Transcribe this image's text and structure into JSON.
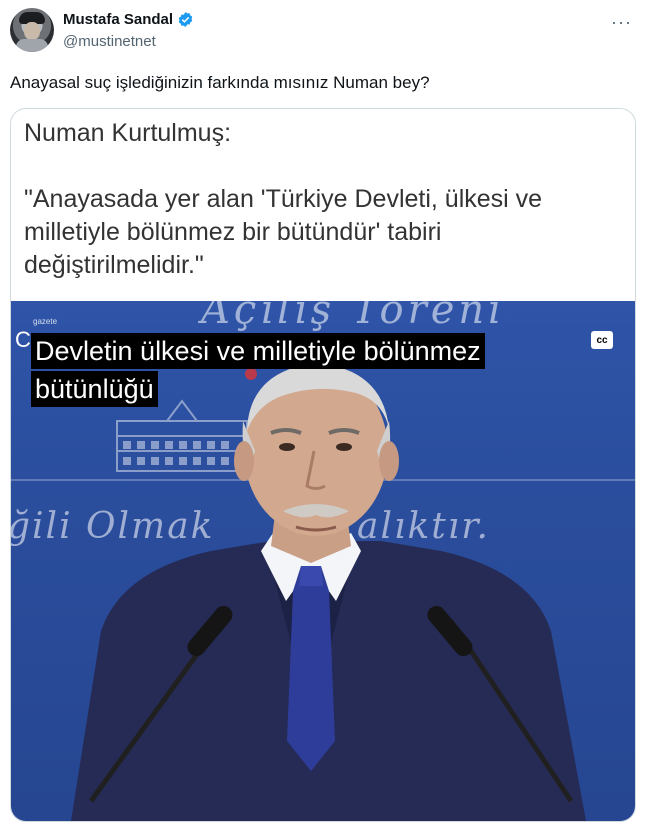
{
  "author": {
    "display_name": "Mustafa Sandal",
    "handle": "@mustinetnet",
    "verified_color": "#1d9bf0"
  },
  "more_label": "···",
  "tweet": {
    "text": "Anayasal suç işlediğinizin farkında mısınız Numan bey?"
  },
  "quote": {
    "title": "Numan Kurtulmuş:",
    "body": "\"Anayasada yer alan 'Türkiye Devleti, ülkesi ve milletiyle bölünmez bir bütündür' tabiri değiştirilmelidir.\""
  },
  "video": {
    "caption_line1": "Devletin ülkesi ve milletiyle bölünmez",
    "caption_line2": "bütünlüğü",
    "cc_label": "cc",
    "bg_text_top": "Açılış Töreni",
    "bg_text_bottom_left": "ğili Olmak",
    "bg_text_bottom_right": "alıktır.",
    "logo_text": "gazete",
    "side_letter": "C"
  }
}
